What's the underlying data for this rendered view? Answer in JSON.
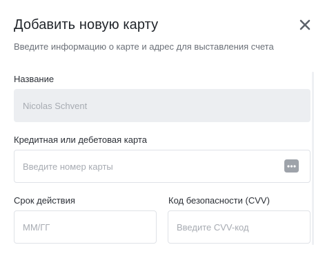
{
  "dialog": {
    "title": "Добавить новую карту",
    "subtitle": "Введите информацию о карте и адрес для выставления счета"
  },
  "fields": {
    "name": {
      "label": "Название",
      "value": "Nicolas Schvent"
    },
    "card": {
      "label": "Кредитная или дебетовая карта",
      "placeholder": "Введите номер карты"
    },
    "expiry": {
      "label": "Срок действия",
      "placeholder": "ММ/ГГ"
    },
    "cvv": {
      "label": "Код безопасности (CVV)",
      "placeholder": "Введите CVV-код"
    }
  },
  "icons": {
    "close": "close-icon",
    "card": "credit-card-icon"
  },
  "colors": {
    "title": "#1f2329",
    "muted": "#6b7078",
    "disabled_bg": "#eceef1",
    "icon_gray": "#9ea3aa"
  }
}
